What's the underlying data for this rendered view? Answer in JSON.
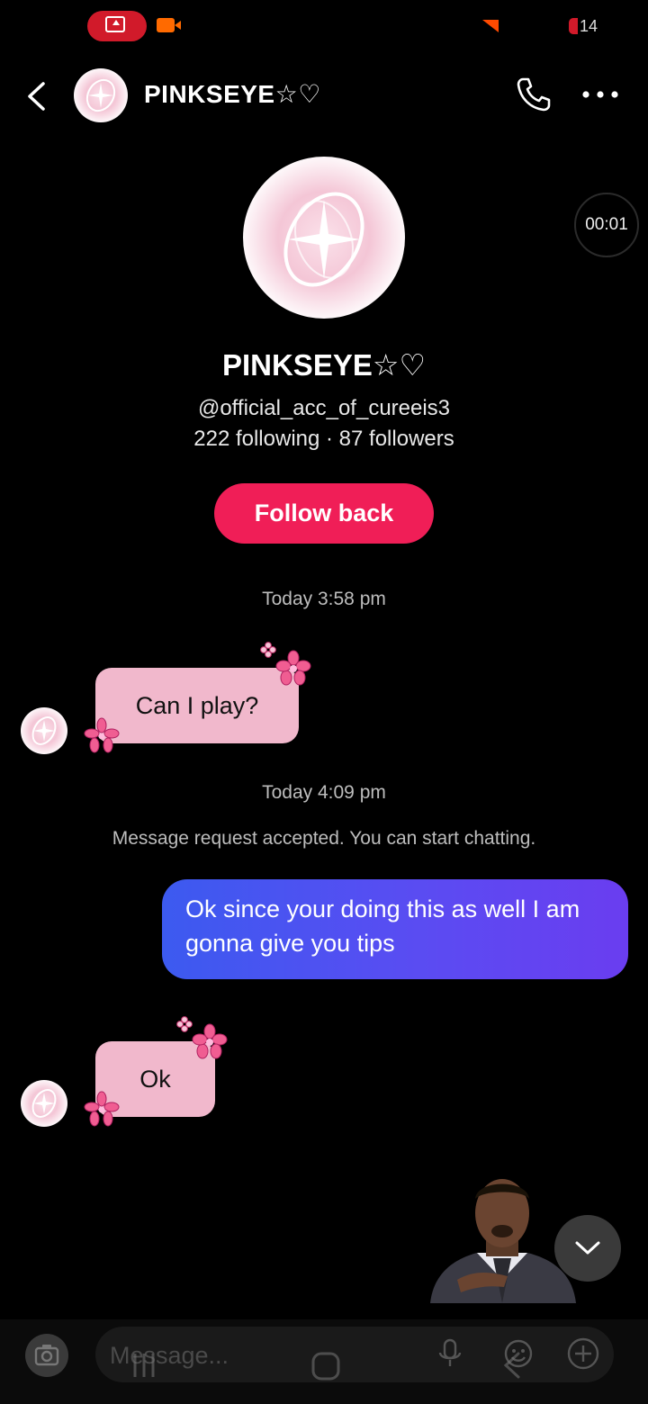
{
  "status_bar": {
    "battery_text": "14",
    "icons": [
      "screen-record-icon",
      "video-camera-icon",
      "signal-icon",
      "battery-icon"
    ]
  },
  "header": {
    "name": "PINKSEYE☆♡",
    "icons": [
      "chevron-left-icon",
      "phone-icon",
      "more-icon"
    ]
  },
  "profile": {
    "name": "PINKSEYE☆♡",
    "handle": "@official_acc_of_cureeis3",
    "stats": "222 following · 87 followers",
    "follow_label": "Follow back",
    "timer": "00:01"
  },
  "messages": {
    "timestamp_1": "Today 3:58 pm",
    "incoming_1": "Can I play?",
    "timestamp_2": "Today 4:09 pm",
    "system_note": "Message request accepted. You can start chatting.",
    "outgoing_1": "Ok since your doing this as well I am gonna give you tips",
    "incoming_2": "Ok"
  },
  "composer": {
    "placeholder": "Message...",
    "icons": [
      "camera-icon",
      "microphone-icon",
      "sticker-icon",
      "plus-icon"
    ]
  },
  "colors": {
    "follow_button": "#f01e57",
    "incoming_bubble": "#f1b8cc",
    "outgoing_bubble_start": "#3c5af0",
    "outgoing_bubble_end": "#6a3df0"
  }
}
